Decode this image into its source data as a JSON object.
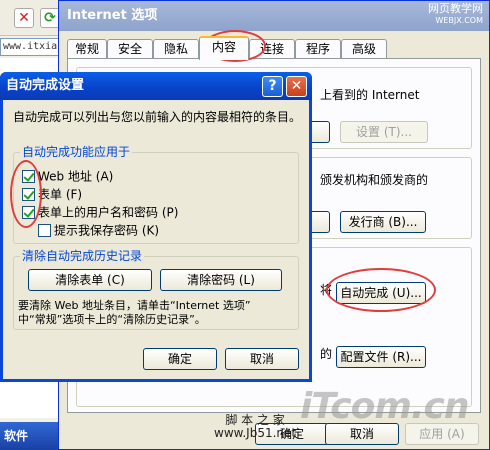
{
  "background": {
    "address_text": "www.itxiaza",
    "taskbar_text": "软件"
  },
  "internet_options": {
    "title": "Internet 选项",
    "watermark_top": "网页教学网",
    "watermark_url": "WEBJX.COM",
    "tabs": [
      "常规",
      "安全",
      "隐私",
      "内容",
      "连接",
      "程序",
      "高级"
    ],
    "active_tab": "内容",
    "fragment_internet": "上看到的 Internet",
    "fragment_publisher": "颁发机构和颁发商的",
    "fragment_jiang": "将",
    "fragment_de": "的",
    "settings_button": "设置 (T)...",
    "publishers_button": "发行商 (B)...",
    "autocomplete_button": "自动完成 (U)...",
    "profile_button": "配置文件 (R)...",
    "ok_button": "确定",
    "cancel_button": "取消",
    "apply_button": "应用 (A)"
  },
  "autocomplete_dialog": {
    "title": "自动完成设置",
    "help_glyph": "?",
    "close_glyph": "✕",
    "description": "自动完成可以列出与您以前输入的内容最相符的条目。",
    "apply_group_label": "自动完成功能应用于",
    "options": [
      {
        "label": "Web 地址 (A)",
        "checked": true
      },
      {
        "label": "表单 (F)",
        "checked": true
      },
      {
        "label": "表单上的用户名和密码 (P)",
        "checked": true
      },
      {
        "label": "提示我保存密码 (K)",
        "checked": false
      }
    ],
    "clear_group_label": "清除自动完成历史记录",
    "clear_forms_button": "清除表单 (C)",
    "clear_passwords_button": "清除密码 (L)",
    "clear_note_line1": "要清除 Web 地址条目，请单击“Internet 选项”",
    "clear_note_line2": "中“常规”选项卡上的“清除历史记录”。",
    "ok_button": "确定",
    "cancel_button": "取消"
  },
  "footer_watermark": {
    "logo_text": "iTcom.cn",
    "site_name": "脚 本 之 家",
    "site_url": "www.Jb51.net"
  }
}
